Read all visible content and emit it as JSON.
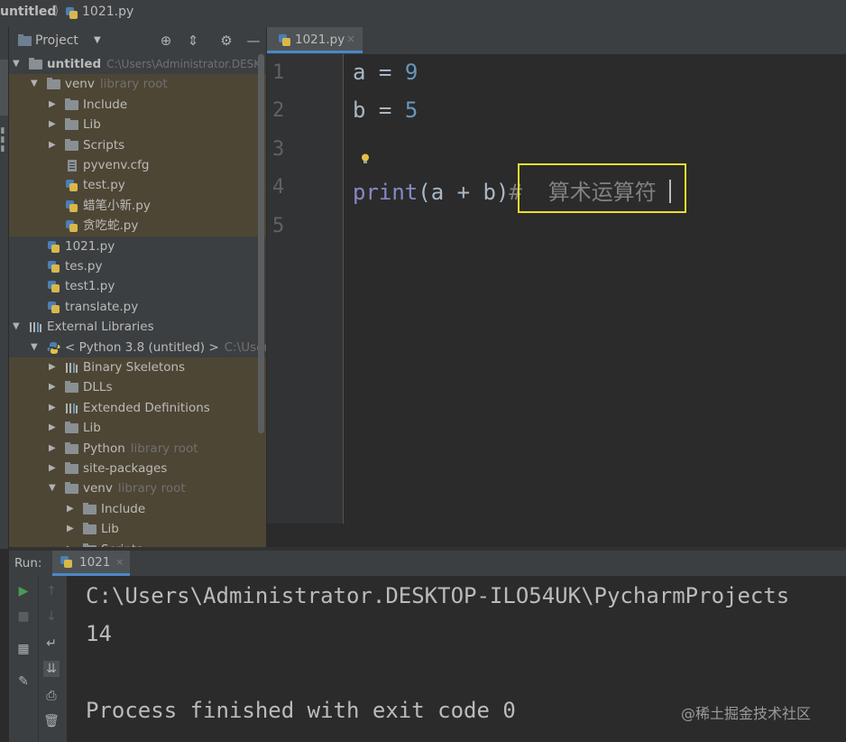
{
  "breadcrumb": {
    "project": "untitled",
    "file": "1021.py"
  },
  "project_panel": {
    "title": "Project",
    "tree": [
      {
        "label": "untitled",
        "note": "C:\\Users\\Administrator.DESK",
        "kind": "folder",
        "expanded": true,
        "level": 0,
        "bold": true
      },
      {
        "label": "venv",
        "note": "library root",
        "kind": "folder",
        "expanded": true,
        "level": 1
      },
      {
        "label": "Include",
        "kind": "folder",
        "expanded": false,
        "level": 2
      },
      {
        "label": "Lib",
        "kind": "folder",
        "expanded": false,
        "level": 2
      },
      {
        "label": "Scripts",
        "kind": "folder",
        "expanded": false,
        "level": 2
      },
      {
        "label": "pyvenv.cfg",
        "kind": "file",
        "level": 2
      },
      {
        "label": "test.py",
        "kind": "py",
        "level": 2
      },
      {
        "label": "蜡笔小新.py",
        "kind": "py",
        "level": 2
      },
      {
        "label": "贪吃蛇.py",
        "kind": "py",
        "level": 2
      },
      {
        "label": "1021.py",
        "kind": "py",
        "level": 1
      },
      {
        "label": "tes.py",
        "kind": "py",
        "level": 1
      },
      {
        "label": "test1.py",
        "kind": "py",
        "level": 1
      },
      {
        "label": "translate.py",
        "kind": "py",
        "level": 1
      },
      {
        "label": "External Libraries",
        "kind": "lib",
        "expanded": true,
        "level": 0
      },
      {
        "label": "< Python 3.8 (untitled) >",
        "note": "C:\\Users\\",
        "kind": "python",
        "expanded": true,
        "level": 1
      },
      {
        "label": "Binary Skeletons",
        "kind": "lib",
        "expanded": false,
        "level": 2
      },
      {
        "label": "DLLs",
        "kind": "folder",
        "expanded": false,
        "level": 2
      },
      {
        "label": "Extended Definitions",
        "kind": "lib",
        "expanded": false,
        "level": 2
      },
      {
        "label": "Lib",
        "kind": "folder",
        "expanded": false,
        "level": 2
      },
      {
        "label": "Python",
        "note": "library root",
        "kind": "folder",
        "expanded": false,
        "level": 2
      },
      {
        "label": "site-packages",
        "kind": "folder",
        "expanded": false,
        "level": 2
      },
      {
        "label": "venv",
        "note": "library root",
        "kind": "folder",
        "expanded": true,
        "level": 2
      },
      {
        "label": "Include",
        "kind": "folder",
        "expanded": false,
        "level": 3
      },
      {
        "label": "Lib",
        "kind": "folder",
        "expanded": false,
        "level": 3
      },
      {
        "label": "Scripts",
        "kind": "folder",
        "expanded": false,
        "level": 3
      }
    ]
  },
  "editor": {
    "tab_label": "1021.py",
    "line_numbers": [
      "1",
      "2",
      "3",
      "4",
      "5"
    ],
    "line1": {
      "var": "a",
      "op": " = ",
      "num": "9"
    },
    "line2": {
      "var": "b",
      "op": " = ",
      "num": "5"
    },
    "line4": {
      "fn": "print",
      "args": "(a + b)",
      "comment": "#  算术运算符"
    }
  },
  "run_panel": {
    "label": "Run:",
    "tab_label": "1021",
    "output": [
      "C:\\Users\\Administrator.DESKTOP-ILO54UK\\PycharmProjects",
      "14",
      "",
      "Process finished with exit code 0"
    ]
  },
  "watermark": "@稀土掘金技术社区",
  "colors": {
    "accent": "#4a88c7",
    "focus_box": "#e8e02c",
    "number": "#6897bb",
    "builtin": "#8888c6",
    "comment": "#808080",
    "run_green": "#499c54"
  }
}
